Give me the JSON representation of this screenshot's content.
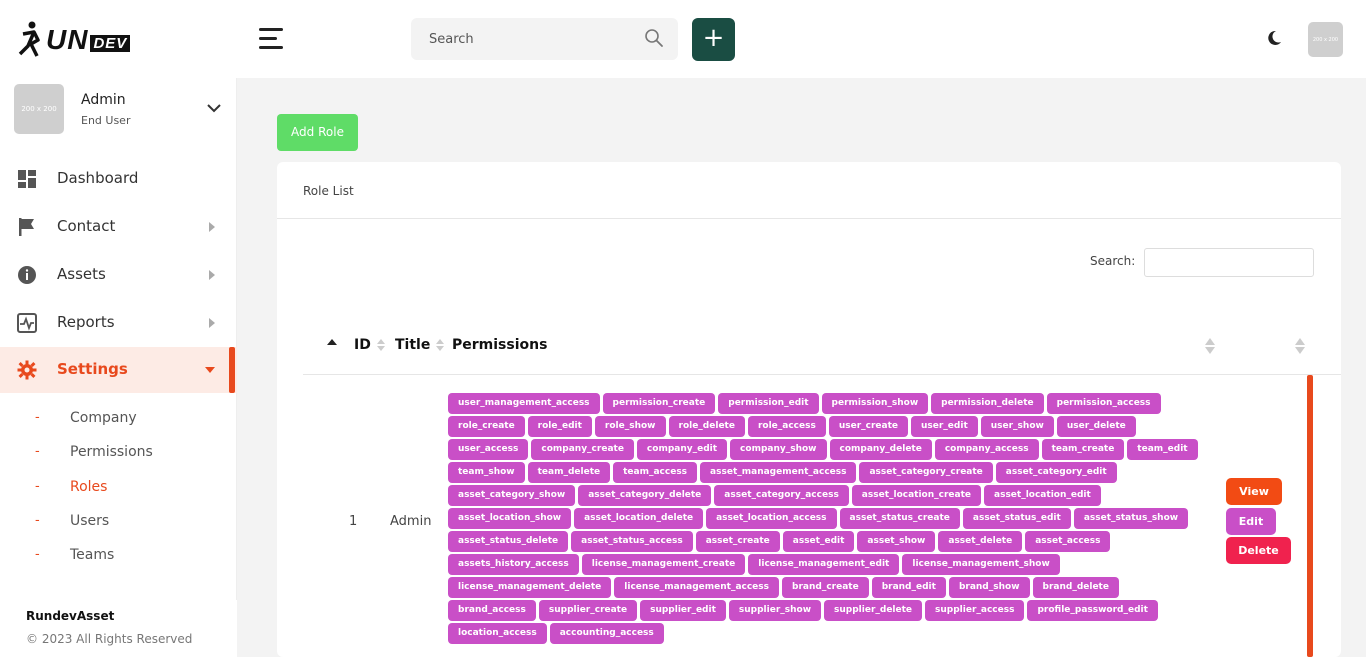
{
  "brand": {
    "logo_main": "UN",
    "logo_accent": "DEV",
    "logo_prefix_icon": "runner-r-icon"
  },
  "header": {
    "menu_icon": "hamburger-icon",
    "search_placeholder": "Search",
    "search_icon": "search-icon",
    "add_label": "+",
    "theme_icon": "moon-icon",
    "avatar_text": "200 x 200"
  },
  "user": {
    "name": "Admin",
    "role": "End User",
    "avatar_text": "200 x 200"
  },
  "sidebar": {
    "items": [
      {
        "label": "Dashboard",
        "icon": "dashboard-icon"
      },
      {
        "label": "Contact",
        "icon": "flag-icon"
      },
      {
        "label": "Assets",
        "icon": "info-icon"
      },
      {
        "label": "Reports",
        "icon": "activity-icon"
      },
      {
        "label": "Settings",
        "icon": "gear-icon"
      }
    ],
    "subitems": [
      "Company",
      "Permissions",
      "Roles",
      "Users",
      "Teams"
    ],
    "active_item": "Settings",
    "active_subitem": "Roles"
  },
  "footer": {
    "brand": "RundevAsset",
    "copyright": "© 2023 All Rights Reserved"
  },
  "main": {
    "add_role_label": "Add Role",
    "card_title": "Role List",
    "search_label": "Search:",
    "columns": [
      "ID",
      "Title",
      "Permissions"
    ],
    "rows": [
      {
        "id": "1",
        "title": "Admin",
        "permissions": [
          "user_management_access",
          "permission_create",
          "permission_edit",
          "permission_show",
          "permission_delete",
          "permission_access",
          "role_create",
          "role_edit",
          "role_show",
          "role_delete",
          "role_access",
          "user_create",
          "user_edit",
          "user_show",
          "user_delete",
          "user_access",
          "company_create",
          "company_edit",
          "company_show",
          "company_delete",
          "company_access",
          "team_create",
          "team_edit",
          "team_show",
          "team_delete",
          "team_access",
          "asset_management_access",
          "asset_category_create",
          "asset_category_edit",
          "asset_category_show",
          "asset_category_delete",
          "asset_category_access",
          "asset_location_create",
          "asset_location_edit",
          "asset_location_show",
          "asset_location_delete",
          "asset_location_access",
          "asset_status_create",
          "asset_status_edit",
          "asset_status_show",
          "asset_status_delete",
          "asset_status_access",
          "asset_create",
          "asset_edit",
          "asset_show",
          "asset_delete",
          "asset_access",
          "assets_history_access",
          "license_management_create",
          "license_management_edit",
          "license_management_show",
          "license_management_delete",
          "license_management_access",
          "brand_create",
          "brand_edit",
          "brand_show",
          "brand_delete",
          "brand_access",
          "supplier_create",
          "supplier_edit",
          "supplier_show",
          "supplier_delete",
          "supplier_access",
          "profile_password_edit",
          "location_access",
          "accounting_access"
        ],
        "actions": {
          "view": "View",
          "edit": "Edit",
          "delete": "Delete"
        }
      }
    ]
  },
  "colors": {
    "accent": "#e8491d",
    "add_role": "#5fdc67",
    "plus_button": "#1a4d43",
    "permission_badge": "#c94fc7",
    "view": "#f24b14",
    "delete": "#f0224e"
  }
}
